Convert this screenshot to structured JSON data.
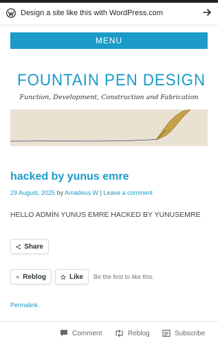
{
  "wpbar": {
    "text": "Design a site like this with WordPress.com"
  },
  "menu": {
    "label": "MENU"
  },
  "site": {
    "title": "FOUNTAIN PEN DESIGN",
    "description": "Function, Development, Construction and Fabrication"
  },
  "post": {
    "title": "hacked by yunus emre",
    "date": "29 August, 2025",
    "by": "by",
    "author": "Amadeus W",
    "separator": "|",
    "comment_link": "Leave a comment",
    "body": "HELLO ADMİN YUNUS EMRE HACKED BY YUNUSEMRE"
  },
  "sharing": {
    "share_label": "Share"
  },
  "likes": {
    "reblog_label": "Reblog",
    "like_label": "Like",
    "note": "Be the first to like this."
  },
  "permalink": "Permalink.",
  "bottom_bar": {
    "comment": "Comment",
    "reblog": "Reblog",
    "subscribe": "Subscribe"
  },
  "colors": {
    "accent": "#1a9bc8",
    "wp_dark": "#1d2327"
  },
  "icons": [
    "wordpress-icon",
    "arrow-right-icon",
    "share-icon",
    "reblog-icon",
    "star-icon",
    "comment-icon",
    "subscribe-icon"
  ]
}
